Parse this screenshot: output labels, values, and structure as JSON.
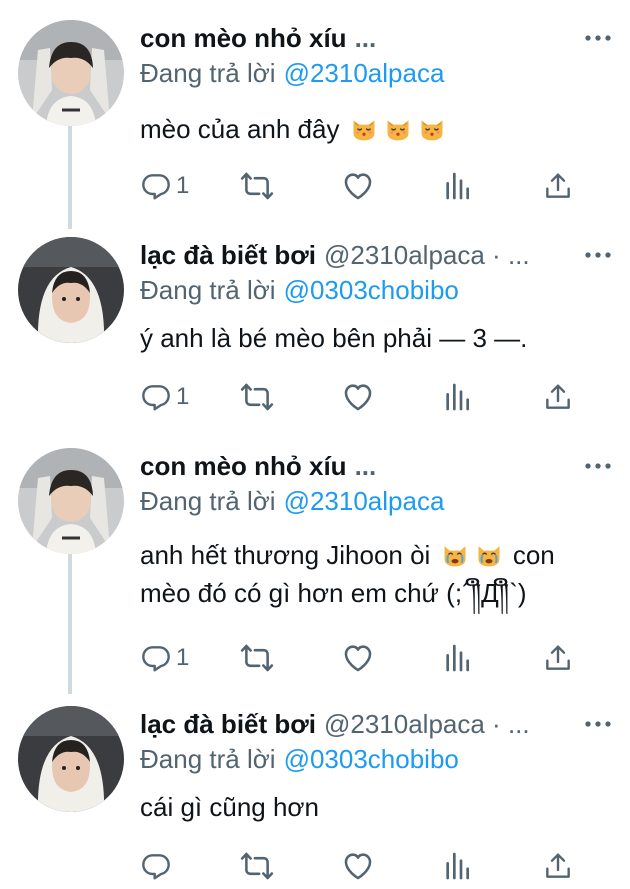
{
  "tweets": [
    {
      "display_name": "con mèo nhỏ xíu",
      "handle": "",
      "ellipsis": "...",
      "reply_prefix": "Đang trả lời",
      "reply_to": "@2310alpaca",
      "text_before": "mèo của anh đây",
      "text_after": "",
      "text_line2": "",
      "emoji": [
        "kissing-cat",
        "kissing-cat",
        "kissing-cat"
      ],
      "reply_count": "1",
      "avatar": "avatar-arms-raised"
    },
    {
      "display_name": "lạc đà biết bơi",
      "handle": "@2310alpaca · ...",
      "ellipsis": "",
      "reply_prefix": "Đang trả lời",
      "reply_to": "@0303chobibo",
      "text_before": "ý anh là bé mèo bên phải — 3 —.",
      "text_after": "",
      "text_line2": "",
      "emoji": [],
      "reply_count": "1",
      "avatar": "avatar-hood"
    },
    {
      "display_name": "con mèo nhỏ xíu",
      "handle": "",
      "ellipsis": "...",
      "reply_prefix": "Đang trả lời",
      "reply_to": "@2310alpaca",
      "text_before": "anh hết thương Jihoon òi",
      "text_after": "con",
      "text_line2": "mèo đó có gì hơn em chứ (;´༎ຶД༎ຶ`)",
      "emoji": [
        "crying-cat",
        "crying-cat"
      ],
      "reply_count": "1",
      "avatar": "avatar-arms-raised"
    },
    {
      "display_name": "lạc đà biết bơi",
      "handle": "@2310alpaca · ...",
      "ellipsis": "",
      "reply_prefix": "Đang trả lời",
      "reply_to": "@0303chobibo",
      "text_before": "cái gì cũng hơn",
      "text_after": "",
      "text_line2": "",
      "emoji": [],
      "reply_count": "",
      "avatar": "avatar-hood"
    }
  ],
  "icons": {
    "reply": "reply-icon",
    "retweet": "retweet-icon",
    "like": "like-icon",
    "views": "views-icon",
    "share": "share-icon",
    "more": "more-icon"
  },
  "colors": {
    "text": "#0f1419",
    "secondary": "#536471",
    "link": "#1d9bf0",
    "thread_line": "#cfd9de"
  }
}
